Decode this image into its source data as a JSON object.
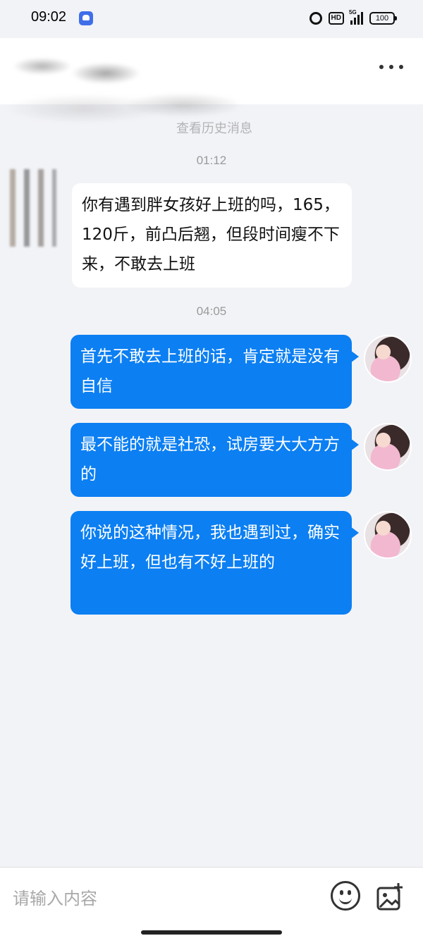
{
  "status_bar": {
    "time": "09:02",
    "network": "5G",
    "hd_badge": "HD",
    "battery": "100"
  },
  "chat": {
    "history_label": "查看历史消息",
    "messages": [
      {
        "timestamp": "01:12"
      },
      {
        "direction": "in",
        "text": "你有遇到胖女孩好上班的吗，165，120斤，前凸后翘，但段时间瘦不下来，不敢去上班"
      },
      {
        "timestamp": "04:05"
      },
      {
        "direction": "out",
        "text": "首先不敢去上班的话，肯定就是没有自信"
      },
      {
        "direction": "out",
        "text": "最不能的就是社恐，试房要大大方方的"
      },
      {
        "direction": "out",
        "text": "你说的这种情况，我也遇到过，确实好上班，但也有不好上班的"
      }
    ]
  },
  "input": {
    "placeholder": "请输入内容"
  },
  "colors": {
    "outgoing_bubble": "#0c7ff2",
    "incoming_bubble": "#ffffff",
    "background": "#f2f3f7"
  },
  "icons": {
    "more": "more-dots-icon",
    "emoji": "emoji-icon",
    "image": "image-add-icon"
  }
}
